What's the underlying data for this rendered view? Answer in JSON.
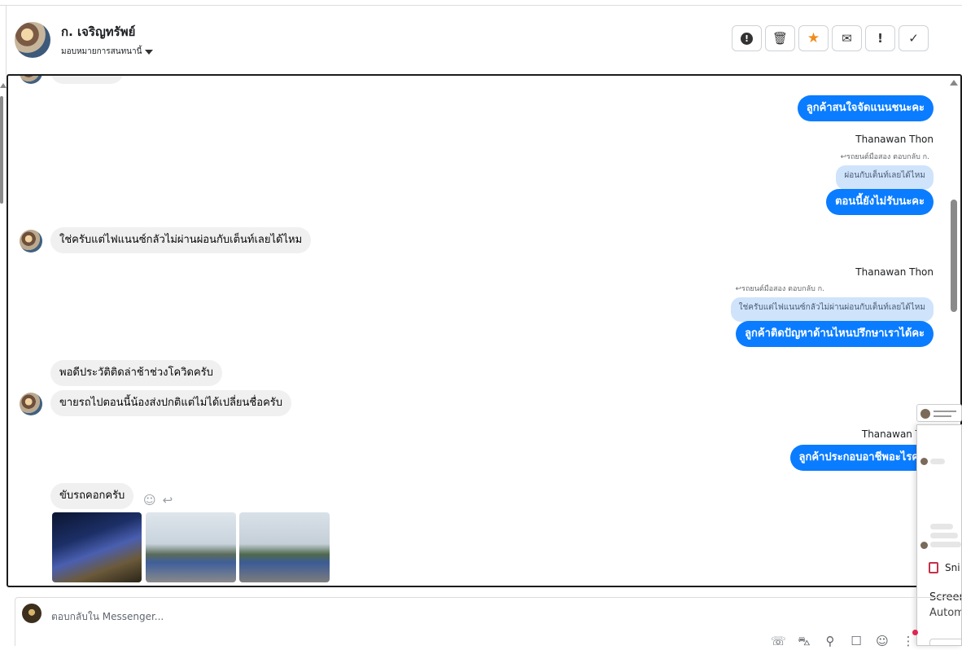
{
  "header": {
    "contact_name": "ก. เจริญทรัพย์",
    "assign_label": "มอบหมายการสนทนานี้",
    "actions": [
      {
        "name": "spam-button",
        "icon": "alert-circle-icon",
        "glyph": "!"
      },
      {
        "name": "delete-button",
        "icon": "trash-icon",
        "glyph": "🗑"
      },
      {
        "name": "star-button",
        "icon": "star-icon",
        "glyph": "★"
      },
      {
        "name": "mark-unread-button",
        "icon": "envelope-icon",
        "glyph": "✉"
      },
      {
        "name": "follow-up-button",
        "icon": "exclamation-icon",
        "glyph": "!"
      },
      {
        "name": "done-button",
        "icon": "check-icon",
        "glyph": "✓"
      }
    ]
  },
  "messages": {
    "m1_out": "ลูกค้าสนใจจัดแนนชนะคะ",
    "m2_sender": "Thanawan Thon",
    "m2_reply_note": "รถยนต์มือสอง ตอบกลับ ก.",
    "m2_quote": "ผ่อนกับเต็นท์เลยได้ไหม",
    "m2_out": "ตอนนี้ยังไม่รับนะคะ",
    "m3_in": "ใช่ครับแต่ไฟแนนซ์กลัวไม่ผ่านผ่อนกับเต็นท์เลยได้ไหม",
    "m4_sender": "Thanawan Thon",
    "m4_reply_note": "รถยนต์มือสอง ตอบกลับ ก.",
    "m4_quote": "ใช่ครับแต่ไฟแนนซ์กลัวไม่ผ่านผ่อนกับเต็นท์เลยได้ไหม",
    "m4_out": "ลูกค้าติดปัญหาด้านไหนปรึกษาเราได้คะ",
    "m5_in": "พอดีประวัติติดล่าช้าช่วงโควิดครับ",
    "m6_in": "ขายรถไปตอนนี้น้องส่งปกติแต่ไม่ได้เปลี่ยนชื่อครับ",
    "m7_sender": "Thanawan Tho",
    "m7_out": "ลูกค้าประกอบอาชีพอะไรคะ",
    "m8_in": "ขับรถคอกครับ"
  },
  "popup": {
    "snip_label": "Sni",
    "screen_label": "Screen",
    "auto_label": "Autom"
  },
  "composer": {
    "placeholder": "ตอบกลับใน Messenger..."
  },
  "colors": {
    "outgoing": "#0a7cff",
    "incoming": "#f0f0f0",
    "quote": "#cfe3fb",
    "star": "#f08b1d"
  }
}
